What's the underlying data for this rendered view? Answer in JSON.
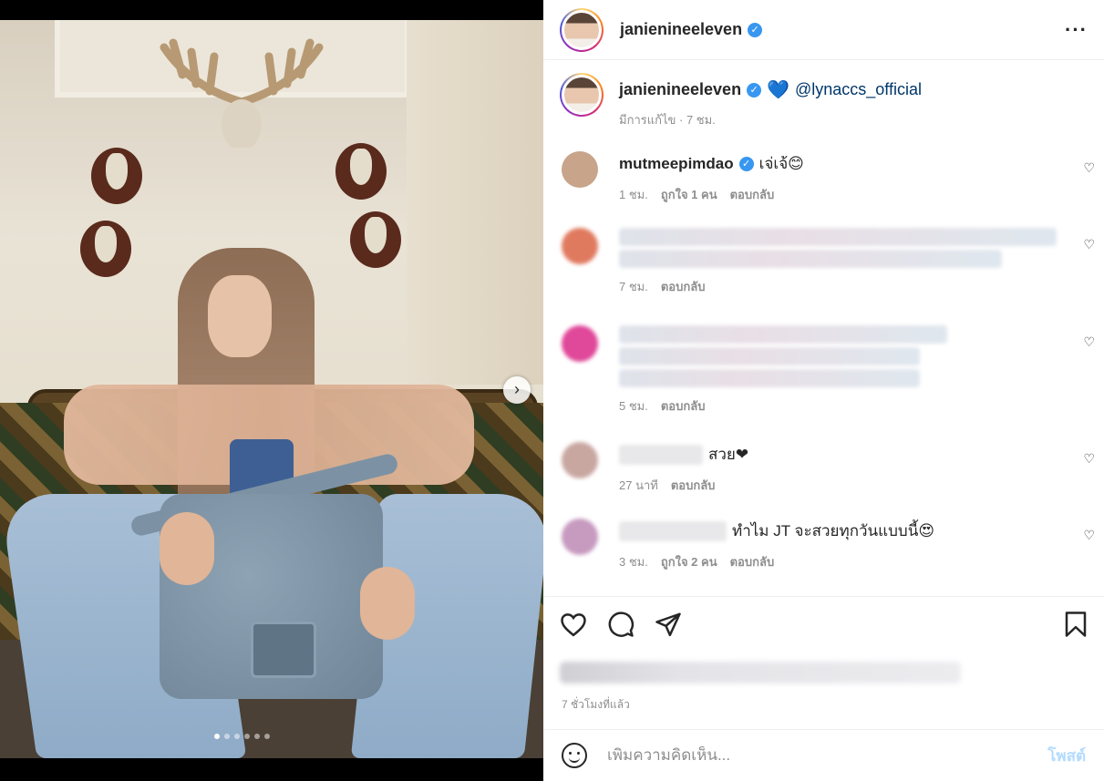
{
  "post": {
    "author": "janienineeleven",
    "more_label": "···",
    "verified_mark": "✓",
    "image_dots": 6,
    "active_dot": 0,
    "next_label": "›"
  },
  "caption": {
    "username": "janienineeleven",
    "heart": "💙",
    "mention": "@lynaccs_official",
    "meta": "มีการแก้ไข · 7 ชม."
  },
  "comments": [
    {
      "username": "mutmeepimdao",
      "text": "เจ่เจ้😊",
      "time": "1 ชม.",
      "likes": "ถูกใจ 1 คน",
      "reply": "ตอบกลับ",
      "avatar_color": "#c8a48a"
    },
    {
      "username": "",
      "text": "",
      "time": "7 ชม.",
      "likes": "",
      "reply": "ตอบกลับ",
      "avatar_color": "#e07a5f"
    },
    {
      "username": "",
      "text": "",
      "time": "5 ชม.",
      "likes": "",
      "reply": "ตอบกลับ",
      "avatar_color": "#e0489a"
    },
    {
      "username": "",
      "text": "สวย❤",
      "time": "27 นาที",
      "likes": "",
      "reply": "ตอบกลับ",
      "avatar_color": "#c9a7a1"
    },
    {
      "username": "",
      "text": "ทำไม JT จะสวยทุกวันแบบนี้😍",
      "time": "3 ชม.",
      "likes": "ถูกใจ 2 คน",
      "reply": "ตอบกลับ",
      "avatar_color": "#c79ac0"
    }
  ],
  "actions": {
    "like_icon": "heart-icon",
    "comment_icon": "comment-icon",
    "share_icon": "share-icon",
    "save_icon": "bookmark-icon"
  },
  "time_ago": "7 ชั่วโมงที่แล้ว",
  "add_comment": {
    "placeholder": "เพิ่มความคิดเห็น...",
    "post_label": "โพสต์"
  }
}
